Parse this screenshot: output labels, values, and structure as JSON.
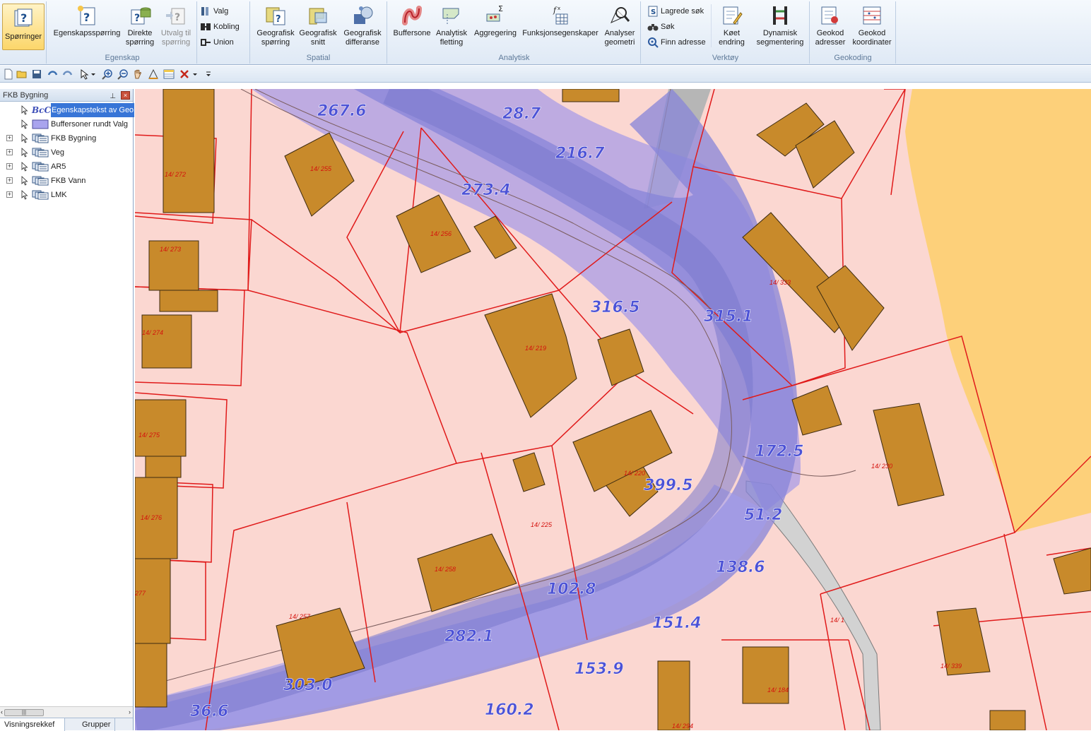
{
  "ribbon": {
    "groups": {
      "egenskap": "Egenskap",
      "spatial": "Spatial",
      "analytisk": "Analytisk",
      "verktoy": "Verktøy",
      "geokoding": "Geokoding"
    },
    "buttons": {
      "sporringer": "Spørringer",
      "egenskapssporring": "Egenskapsspørring",
      "direkte_1": "Direkte",
      "direkte_2": "spørring",
      "utvalg_1": "Utvalg til",
      "utvalg_2": "spørring",
      "valg": "Valg",
      "kobling": "Kobling",
      "union": "Union",
      "geo_sporring_1": "Geografisk",
      "geo_sporring_2": "spørring",
      "geo_snitt_1": "Geografisk",
      "geo_snitt_2": "snitt",
      "geo_diff_1": "Geografisk",
      "geo_diff_2": "differanse",
      "buffersone": "Buffersone",
      "analytisk_1": "Analytisk",
      "analytisk_2": "fletting",
      "aggregering": "Aggregering",
      "funksjon": "Funksjonsegenskaper",
      "analyser_1": "Analyser",
      "analyser_2": "geometri",
      "lagrede_sok": "Lagrede søk",
      "sok": "Søk",
      "finn_adresse": "Finn adresse",
      "koet_1": "Køet",
      "koet_2": "endring",
      "dyn_1": "Dynamisk",
      "dyn_2": "segmentering",
      "geokod_adr_1": "Geokod",
      "geokod_adr_2": "adresser",
      "geokod_koord_1": "Geokod",
      "geokod_koord_2": "koordinater"
    }
  },
  "panel": {
    "title": "FKB Bygning",
    "tabs": [
      "Visningsrekkef",
      "Grupper"
    ],
    "layers": [
      {
        "name": "Egenskapstekst av Geo",
        "type": "label-layer",
        "selected": true,
        "expandable": false,
        "icon_text": "BcC"
      },
      {
        "name": "Buffersoner rundt Valg",
        "type": "polygon-layer",
        "selected": false,
        "expandable": false
      },
      {
        "name": "FKB Bygning",
        "type": "group-layer",
        "selected": false,
        "expandable": true
      },
      {
        "name": "Veg",
        "type": "group-layer",
        "selected": false,
        "expandable": true
      },
      {
        "name": "AR5",
        "type": "group-layer",
        "selected": false,
        "expandable": true
      },
      {
        "name": "FKB Vann",
        "type": "group-layer",
        "selected": false,
        "expandable": true
      },
      {
        "name": "LMK",
        "type": "group-layer",
        "selected": false,
        "expandable": true
      }
    ]
  },
  "map": {
    "colors": {
      "background": "#fbd7d1",
      "building": "#c88a2b",
      "buffer": "#9c94ea",
      "road_buffer": "#7f7fd6",
      "parcel_line": "#e01a1a",
      "field": "#fdd07a",
      "distance_text": "#4c52d6"
    },
    "distance_labels": [
      "267.6",
      "28.7",
      "216.7",
      "273.4",
      "316.5",
      "315.1",
      "172.5",
      "399.5",
      "51.2",
      "138.6",
      "102.8",
      "282.1",
      "151.4",
      "153.9",
      "303.0",
      "36.6",
      "160.2"
    ],
    "parcel_labels": [
      "14/ 272",
      "14/ 255",
      "14/ 273",
      "14/ 256",
      "14/ 274",
      "14/ 219",
      "14/ 333",
      "14/ 275",
      "14/ 220",
      "14/ 230",
      "14/ 276",
      "14/ 225",
      "14/ 258",
      "277",
      "14/ 257",
      "14/ 1",
      "14/ 339",
      "14/ 184",
      "14/ 294"
    ]
  }
}
